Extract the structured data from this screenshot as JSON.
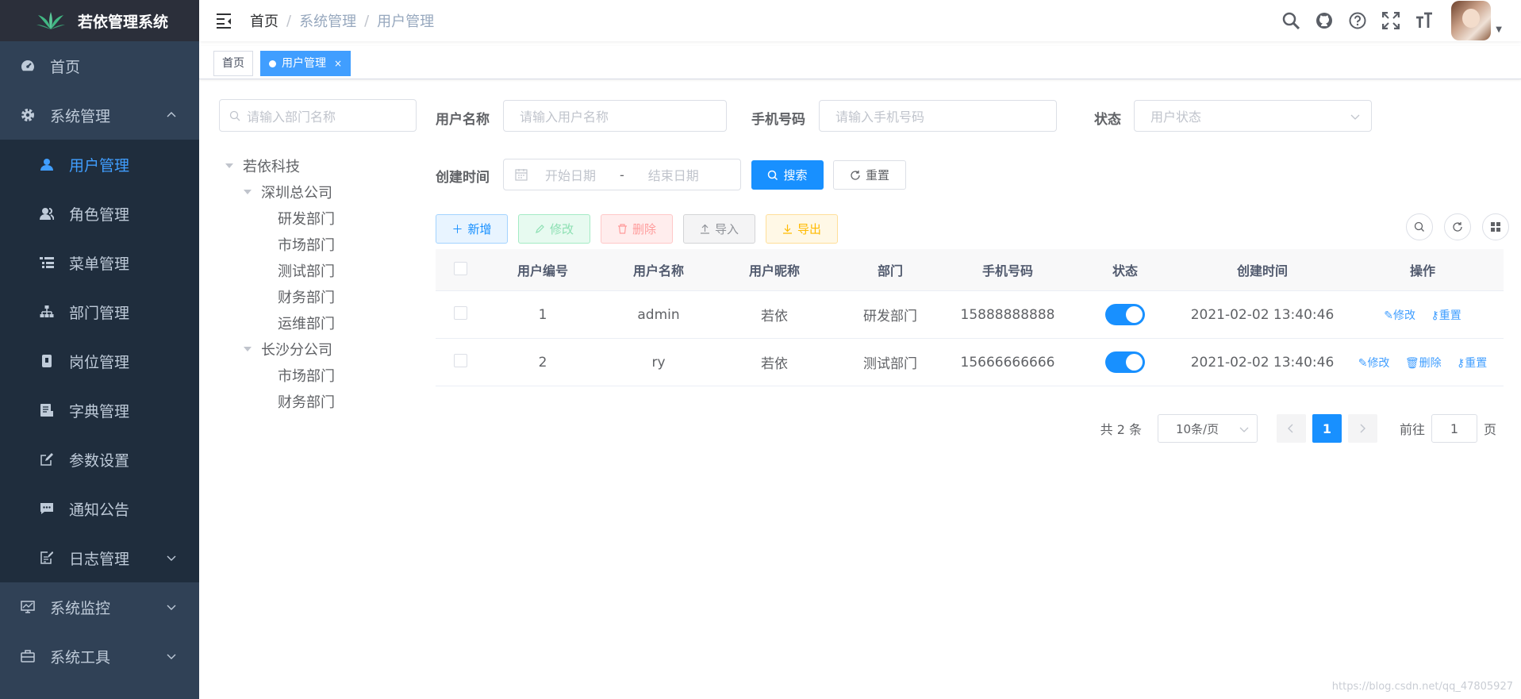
{
  "app": {
    "title": "若依管理系统"
  },
  "sidebar": {
    "items": [
      {
        "label": "首页",
        "icon": "dashboard-icon"
      },
      {
        "label": "系统管理",
        "icon": "gear-icon",
        "expanded": true,
        "children": [
          {
            "label": "用户管理",
            "icon": "user-icon",
            "active": true
          },
          {
            "label": "角色管理",
            "icon": "peoples-icon"
          },
          {
            "label": "菜单管理",
            "icon": "tree-table-icon"
          },
          {
            "label": "部门管理",
            "icon": "tree-icon"
          },
          {
            "label": "岗位管理",
            "icon": "post-icon"
          },
          {
            "label": "字典管理",
            "icon": "dict-icon"
          },
          {
            "label": "参数设置",
            "icon": "edit-icon"
          },
          {
            "label": "通知公告",
            "icon": "message-icon"
          },
          {
            "label": "日志管理",
            "icon": "log-icon"
          }
        ]
      },
      {
        "label": "系统监控",
        "icon": "monitor-icon"
      },
      {
        "label": "系统工具",
        "icon": "tool-icon"
      }
    ]
  },
  "breadcrumb": [
    "首页",
    "系统管理",
    "用户管理"
  ],
  "tags": {
    "home": "首页",
    "active": "用户管理",
    "close": "×"
  },
  "dept": {
    "search_placeholder": "请输入部门名称",
    "tree": [
      {
        "label": "若依科技",
        "level": 0,
        "expandable": true
      },
      {
        "label": "深圳总公司",
        "level": 1,
        "expandable": true
      },
      {
        "label": "研发部门",
        "level": 2
      },
      {
        "label": "市场部门",
        "level": 2
      },
      {
        "label": "测试部门",
        "level": 2
      },
      {
        "label": "财务部门",
        "level": 2
      },
      {
        "label": "运维部门",
        "level": 2
      },
      {
        "label": "长沙分公司",
        "level": 1,
        "expandable": true
      },
      {
        "label": "市场部门",
        "level": 2
      },
      {
        "label": "财务部门",
        "level": 2
      }
    ]
  },
  "form": {
    "username_label": "用户名称",
    "username_placeholder": "请输入用户名称",
    "phone_label": "手机号码",
    "phone_placeholder": "请输入手机号码",
    "status_label": "状态",
    "status_placeholder": "用户状态",
    "created_label": "创建时间",
    "start_placeholder": "开始日期",
    "range_sep": "-",
    "end_placeholder": "结束日期",
    "search_button": "搜索",
    "reset_button": "重置"
  },
  "toolbar": {
    "add": "新增",
    "edit": "修改",
    "delete": "删除",
    "import": "导入",
    "export": "导出"
  },
  "table": {
    "headers": [
      "用户编号",
      "用户名称",
      "用户昵称",
      "部门",
      "手机号码",
      "状态",
      "创建时间",
      "操作"
    ],
    "rows": [
      {
        "id": "1",
        "username": "admin",
        "nickname": "若依",
        "dept": "研发部门",
        "phone": "15888888888",
        "status": true,
        "created": "2021-02-02 13:40:46",
        "ops": [
          "修改",
          "重置"
        ]
      },
      {
        "id": "2",
        "username": "ry",
        "nickname": "若依",
        "dept": "测试部门",
        "phone": "15666666666",
        "status": true,
        "created": "2021-02-02 13:40:46",
        "ops": [
          "修改",
          "删除",
          "重置"
        ]
      }
    ]
  },
  "pagination": {
    "total_text": "共 2 条",
    "page_size": "10条/页",
    "current_page": "1",
    "goto_label": "前往",
    "goto_value": "1",
    "page_suffix": "页"
  },
  "watermark": "https://blog.csdn.net/qq_47805927",
  "colors": {
    "sidebar_bg": "#304156",
    "submenu_bg": "#1f2d3d",
    "primary": "#409eff",
    "switch_on": "#1890ff"
  }
}
